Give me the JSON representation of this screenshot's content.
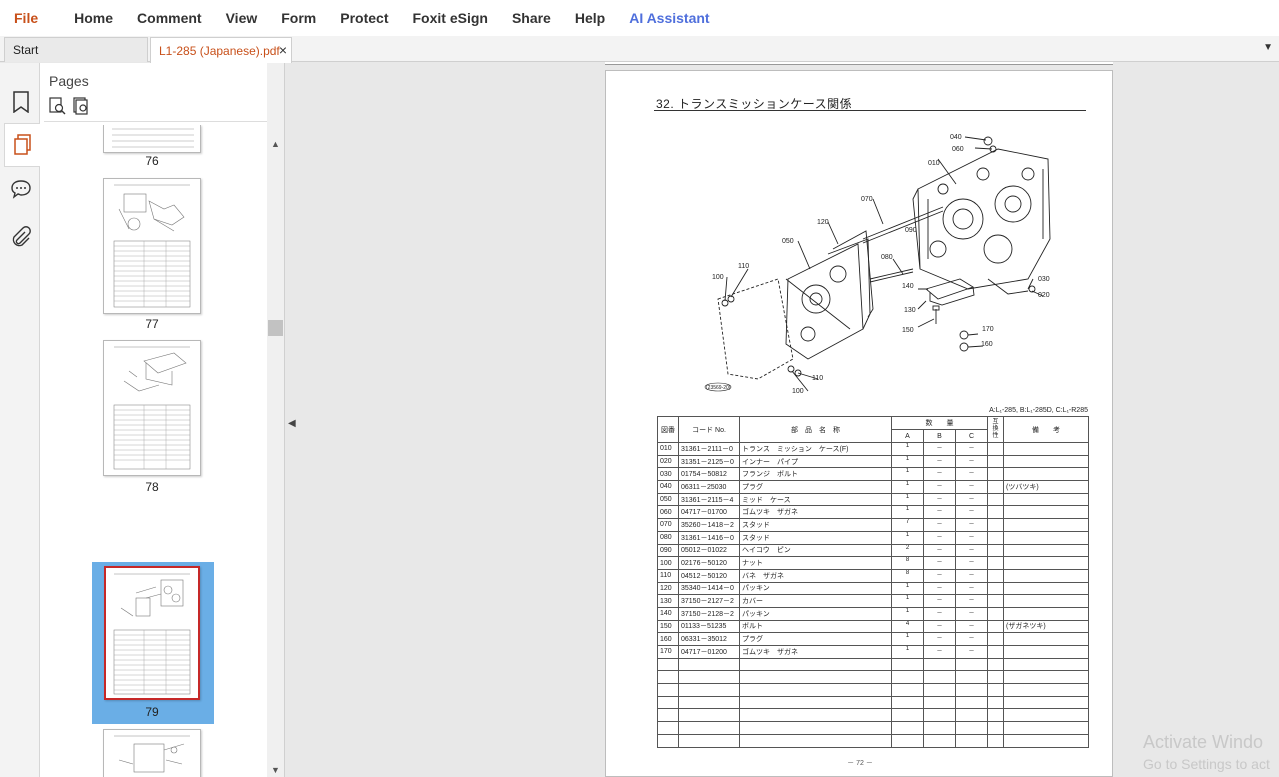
{
  "menu": {
    "items": [
      "File",
      "Home",
      "Comment",
      "View",
      "Form",
      "Protect",
      "Foxit eSign",
      "Share",
      "Help",
      "AI Assistant"
    ]
  },
  "tabs": [
    {
      "label": "Start"
    },
    {
      "label": "L1-285 (Japanese).pdf",
      "close": "×"
    }
  ],
  "tab_menu_icon": "chevron-down-icon",
  "left_toolbar": [
    "bookmark-icon",
    "pages-icon",
    "comment-icon",
    "attachment-icon"
  ],
  "pages_panel": {
    "title": "Pages",
    "tools": [
      "page-zoom-in-icon",
      "page-zoom-out-icon"
    ],
    "thumbnails": [
      {
        "label": "76"
      },
      {
        "label": "77"
      },
      {
        "label": "78"
      },
      {
        "label": "79",
        "selected": true
      },
      {
        "label": ""
      }
    ]
  },
  "document": {
    "title": "32. トランスミッションケース関係",
    "model_note": "A:L₁-285, B:L₁-285D, C:L₁-R285",
    "page_number": "－ 72 －",
    "callouts": [
      "040",
      "060",
      "010",
      "070",
      "120",
      "090",
      "050",
      "080",
      "110",
      "100",
      "140",
      "030",
      "020",
      "130",
      "150",
      "170",
      "160",
      "110",
      "100"
    ],
    "stamp": "(23569-20)",
    "table": {
      "headers": {
        "no": "図番",
        "code": "コード No.",
        "name": "部　品　名　称",
        "qty": "数　　量",
        "a": "A",
        "b": "B",
        "c": "C",
        "interchange": "互換性",
        "remarks": "備　　考"
      },
      "rows": [
        {
          "no": "010",
          "code": "31361－2111－0",
          "name": "トランス　ミッション　ケース(F)",
          "a": "1",
          "b": "－",
          "c": "－",
          "rem": ""
        },
        {
          "no": "020",
          "code": "31351－2125－0",
          "name": "インナー　パイプ",
          "a": "1",
          "b": "－",
          "c": "－",
          "rem": ""
        },
        {
          "no": "030",
          "code": "01754－50812",
          "name": "フランジ　ボルト",
          "a": "1",
          "b": "－",
          "c": "－",
          "rem": ""
        },
        {
          "no": "040",
          "code": "06311－25030",
          "name": "プラグ",
          "a": "1",
          "b": "－",
          "c": "－",
          "rem": "(ツバツキ)"
        },
        {
          "no": "050",
          "code": "31361－2115－4",
          "name": "ミッド　ケース",
          "a": "1",
          "b": "－",
          "c": "－",
          "rem": ""
        },
        {
          "no": "060",
          "code": "04717－01700",
          "name": "ゴムツキ　ザガネ",
          "a": "1",
          "b": "－",
          "c": "－",
          "rem": ""
        },
        {
          "no": "070",
          "code": "35260－1418－2",
          "name": "スタッド",
          "a": "7",
          "b": "－",
          "c": "－",
          "rem": ""
        },
        {
          "no": "080",
          "code": "31361－1416－0",
          "name": "スタッド",
          "a": "1",
          "b": "－",
          "c": "－",
          "rem": ""
        },
        {
          "no": "090",
          "code": "05012－01022",
          "name": "ヘイコウ　ピン",
          "a": "2",
          "b": "－",
          "c": "－",
          "rem": ""
        },
        {
          "no": "100",
          "code": "02176－50120",
          "name": "ナット",
          "a": "8",
          "b": "－",
          "c": "－",
          "rem": ""
        },
        {
          "no": "110",
          "code": "04512－50120",
          "name": "バネ　ザガネ",
          "a": "8",
          "b": "－",
          "c": "－",
          "rem": ""
        },
        {
          "no": "120",
          "code": "35340－1414－0",
          "name": "パッキン",
          "a": "1",
          "b": "－",
          "c": "－",
          "rem": ""
        },
        {
          "no": "130",
          "code": "37150－2127－2",
          "name": "カバー",
          "a": "1",
          "b": "－",
          "c": "－",
          "rem": ""
        },
        {
          "no": "140",
          "code": "37150－2128－2",
          "name": "パッキン",
          "a": "1",
          "b": "－",
          "c": "－",
          "rem": ""
        },
        {
          "no": "150",
          "code": "01133－51235",
          "name": "ボルト",
          "a": "4",
          "b": "－",
          "c": "－",
          "rem": "(ザガネツキ)"
        },
        {
          "no": "160",
          "code": "06331－35012",
          "name": "プラグ",
          "a": "1",
          "b": "－",
          "c": "－",
          "rem": ""
        },
        {
          "no": "170",
          "code": "04717－01200",
          "name": "ゴムツキ　ザガネ",
          "a": "1",
          "b": "－",
          "c": "－",
          "rem": ""
        }
      ],
      "empty_rows": 7
    }
  },
  "watermark": {
    "line1": "Activate Windo",
    "line2": "Go to Settings to act"
  }
}
